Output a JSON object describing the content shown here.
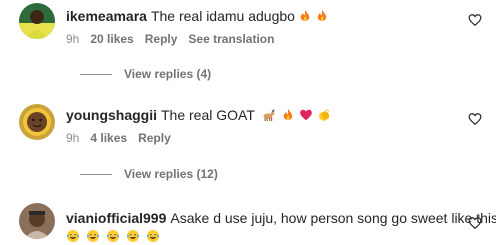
{
  "comments": [
    {
      "username": "ikemeamara",
      "text": "The real idamu adugbo",
      "emojis": [
        "fire",
        "fire"
      ],
      "time": "9h",
      "likes": "20 likes",
      "reply_label": "Reply",
      "translate_label": "See translation",
      "view_replies": "View replies (4)"
    },
    {
      "username": "youngshaggii",
      "text": "The real GOAT",
      "emojis": [
        "goat",
        "fire",
        "red-heart",
        "clapping-hands"
      ],
      "time": "9h",
      "likes": "4 likes",
      "reply_label": "Reply",
      "view_replies": "View replies (12)"
    },
    {
      "username": "vianiofficial999",
      "text": "Asake d use juju, how person song go sweet like this ??",
      "emojis": [
        "laughing-tears",
        "laughing-tears",
        "laughing-tears",
        "laughing-tears",
        "laughing-tears"
      ]
    }
  ],
  "colors": {
    "primary_text": "#262626",
    "secondary_text": "#737373",
    "fire": "#f77b18",
    "heart_red": "#e0245e",
    "laugh_yellow": "#ffcc33"
  }
}
